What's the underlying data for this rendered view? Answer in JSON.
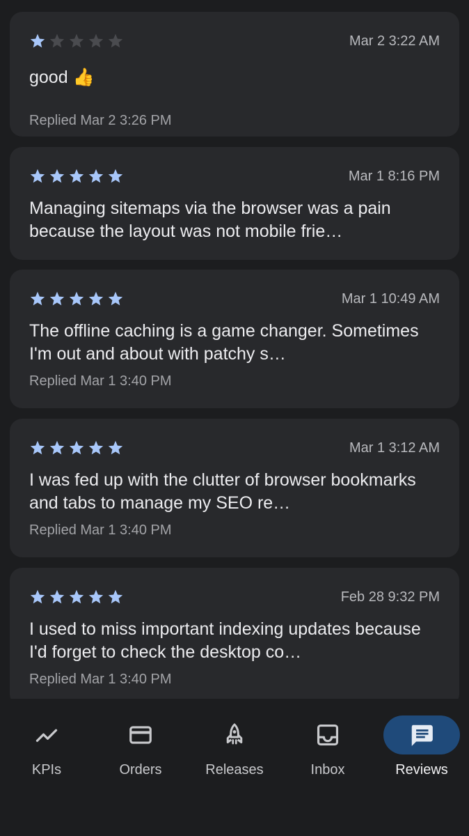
{
  "reviews": [
    {
      "rating": 1,
      "date": "Mar 2 3:22 AM",
      "text": "good 👍",
      "replied": "Replied Mar 2 3:26 PM"
    },
    {
      "rating": 5,
      "date": "Mar 1 8:16 PM",
      "text": "Managing sitemaps via the browser was a pain because the layout was not mobile frie…",
      "replied": ""
    },
    {
      "rating": 5,
      "date": "Mar 1 10:49 AM",
      "text": "The offline caching is a game changer. Sometimes I'm out and about with patchy s…",
      "replied": "Replied Mar 1 3:40 PM"
    },
    {
      "rating": 5,
      "date": "Mar 1 3:12 AM",
      "text": "I was fed up with the clutter of browser bookmarks and tabs to manage my SEO re…",
      "replied": "Replied Mar 1 3:40 PM"
    },
    {
      "rating": 5,
      "date": "Feb 28 9:32 PM",
      "text": "I used to miss important indexing updates because I'd forget to check the desktop co…",
      "replied": "Replied Mar 1 3:40 PM"
    }
  ],
  "nav": [
    {
      "label": "KPIs",
      "icon": "trending-line-icon",
      "active": false
    },
    {
      "label": "Orders",
      "icon": "credit-card-icon",
      "active": false
    },
    {
      "label": "Releases",
      "icon": "rocket-icon",
      "active": false
    },
    {
      "label": "Inbox",
      "icon": "inbox-tray-icon",
      "active": false
    },
    {
      "label": "Reviews",
      "icon": "chat-bubble-icon",
      "active": true
    }
  ],
  "colors": {
    "background": "#1c1d1f",
    "card": "#28292c",
    "star_filled": "#a8c7fa",
    "star_empty": "#4a4b4f",
    "active_pill": "#1f4a7a"
  }
}
